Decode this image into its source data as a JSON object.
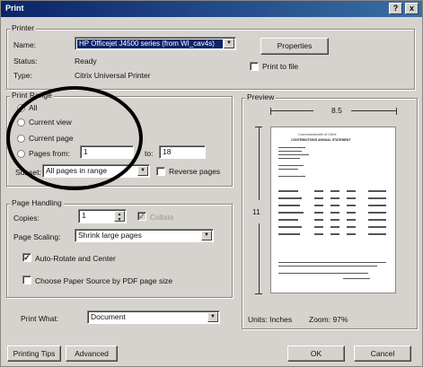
{
  "window": {
    "title": "Print",
    "help_label": "?",
    "close_label": "x"
  },
  "printer": {
    "group_label": "Printer",
    "name_label": "Name:",
    "name_value": "HP Officejet J4500 series (from WI_cav4s)",
    "status_label": "Status:",
    "status_value": "Ready",
    "type_label": "Type:",
    "type_value": "Citrix Universal Printer",
    "properties_label": "Properties",
    "print_to_file_label": "Print to file",
    "print_to_file_checked": false
  },
  "print_range": {
    "group_label": "Print Range",
    "all_label": "All",
    "current_view_label": "Current view",
    "current_page_label": "Current page",
    "pages_from_label": "Pages from:",
    "pages_from_value": "1",
    "to_label": "to:",
    "to_value": "18",
    "selected": "all",
    "subset_label": "Subset:",
    "subset_value": "All pages in range",
    "reverse_pages_label": "Reverse pages"
  },
  "page_handling": {
    "group_label": "Page Handling",
    "copies_label": "Copies:",
    "copies_value": "1",
    "collate_label": "Collate",
    "page_scaling_label": "Page Scaling:",
    "page_scaling_value": "Shrink large pages",
    "auto_rotate_label": "Auto-Rotate and Center",
    "auto_rotate_checked": true,
    "paper_source_label": "Choose Paper Source by PDF page size",
    "paper_source_checked": false
  },
  "print_what": {
    "label": "Print What:",
    "value": "Document"
  },
  "preview": {
    "group_label": "Preview",
    "width_label": "8.5",
    "height_label": "11",
    "doc_title": "Commonwealth of Citrix",
    "doc_subtitle": "CONTRIBUTIONS ANNUAL STATEMENT",
    "units_label": "Units: Inches",
    "zoom_label": "Zoom: 97%"
  },
  "footer": {
    "printing_tips_label": "Printing Tips",
    "advanced_label": "Advanced",
    "ok_label": "OK",
    "cancel_label": "Cancel"
  }
}
